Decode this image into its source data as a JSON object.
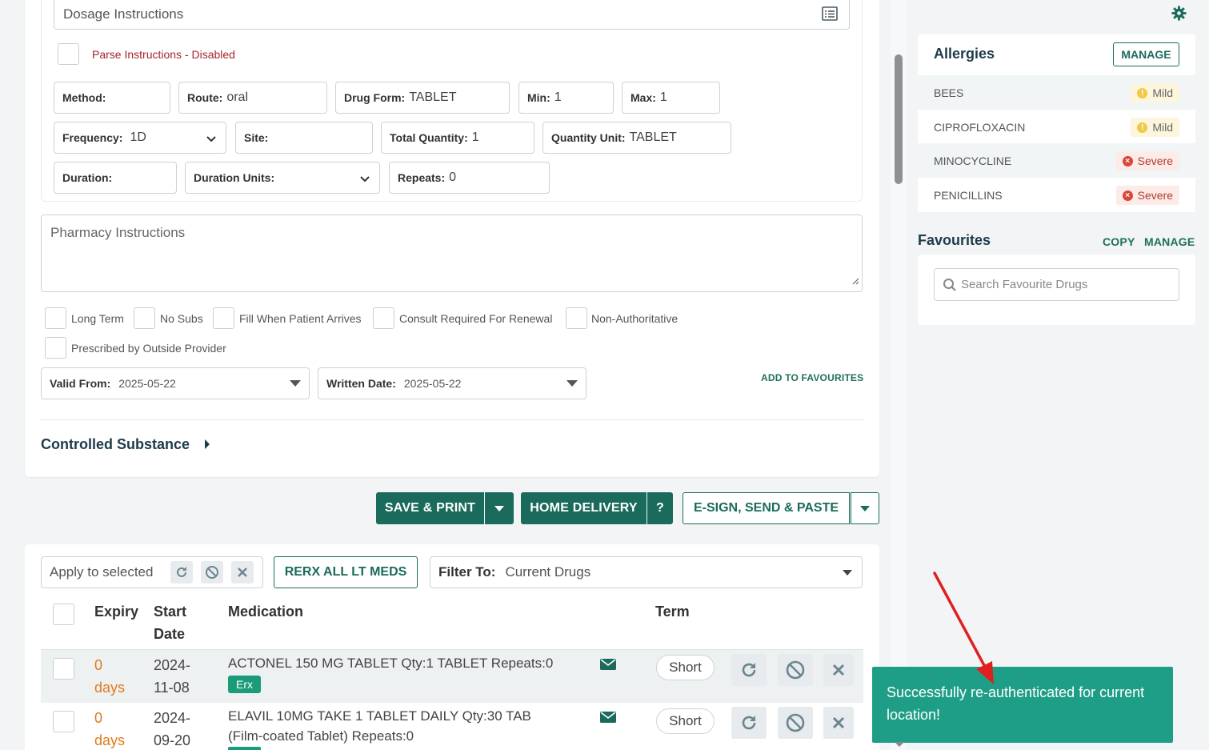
{
  "form": {
    "dosage_instructions_placeholder": "Dosage Instructions",
    "parse_instructions": "Parse Instructions - Disabled",
    "method": {
      "label": "Method:",
      "value": ""
    },
    "route": {
      "label": "Route:",
      "value": "oral"
    },
    "drug_form": {
      "label": "Drug Form:",
      "value": "TABLET"
    },
    "min": {
      "label": "Min:",
      "value": "1"
    },
    "max": {
      "label": "Max:",
      "value": "1"
    },
    "frequency": {
      "label": "Frequency:",
      "value": "1D"
    },
    "site": {
      "label": "Site:",
      "value": ""
    },
    "total_quantity": {
      "label": "Total Quantity:",
      "value": "1"
    },
    "quantity_unit": {
      "label": "Quantity Unit:",
      "value": "TABLET"
    },
    "duration": {
      "label": "Duration:",
      "value": ""
    },
    "duration_units": {
      "label": "Duration Units:",
      "value": ""
    },
    "repeats": {
      "label": "Repeats:",
      "value": "0"
    },
    "pharmacy_instructions_placeholder": "Pharmacy Instructions",
    "checkboxes": {
      "long_term": "Long Term",
      "no_subs": "No Subs",
      "fill_when_arrives": "Fill When Patient Arrives",
      "consult_required": "Consult Required For Renewal",
      "non_authoritative": "Non-Authoritative",
      "outside_provider": "Prescribed by Outside Provider"
    },
    "valid_from": {
      "label": "Valid From:",
      "value": "2025-05-22"
    },
    "written_date": {
      "label": "Written Date:",
      "value": "2025-05-22"
    },
    "add_to_favourites": "ADD TO FAVOURITES",
    "controlled_substance": "Controlled Substance"
  },
  "actions": {
    "save_print": "SAVE & PRINT",
    "home_delivery": "HOME DELIVERY",
    "help": "?",
    "esign": "E-SIGN, SEND & PASTE"
  },
  "list": {
    "apply_to_selected": "Apply to selected",
    "rerx_all": "RERX ALL LT MEDS",
    "filter_label": "Filter To:",
    "filter_value": "Current Drugs",
    "headers": {
      "expiry": "Expiry",
      "start_1": "Start",
      "start_2": "Date",
      "medication": "Medication",
      "term": "Term"
    },
    "rows": [
      {
        "expiry_num": "0",
        "expiry_unit": "days",
        "start_1": "2024-",
        "start_2": "11-08",
        "med_1": "ACTONEL 150 MG TABLET Qty:1 TABLET Repeats:0",
        "med_2": "",
        "badge": "Erx",
        "term": "Short"
      },
      {
        "expiry_num": "0",
        "expiry_unit": "days",
        "start_1": "2024-",
        "start_2": "09-20",
        "med_1": "ELAVIL 10MG TAKE 1 TABLET DAILY Qty:30 TAB",
        "med_2": "(Film-coated Tablet) Repeats:0",
        "badge": "",
        "term": "Short"
      }
    ]
  },
  "sidebar": {
    "allergies_title": "Allergies",
    "allergies_manage": "MANAGE",
    "allergies": [
      {
        "name": "BEES",
        "severity": "Mild"
      },
      {
        "name": "CIPROFLOXACIN",
        "severity": "Mild"
      },
      {
        "name": "MINOCYCLINE",
        "severity": "Severe"
      },
      {
        "name": "PENICILLINS",
        "severity": "Severe"
      }
    ],
    "favourites_title": "Favourites",
    "favourites_copy": "COPY",
    "favourites_manage": "MANAGE",
    "search_placeholder": "Search Favourite Drugs"
  },
  "toast": {
    "message": "Successfully re-authenticated for current location!"
  },
  "colors": {
    "primary": "#1a6b5b",
    "toast": "#1f9e87",
    "expiry": "#e07a1a",
    "severe": "#d9463a",
    "mild": "#f0c94a",
    "arrow": "#e02020"
  }
}
